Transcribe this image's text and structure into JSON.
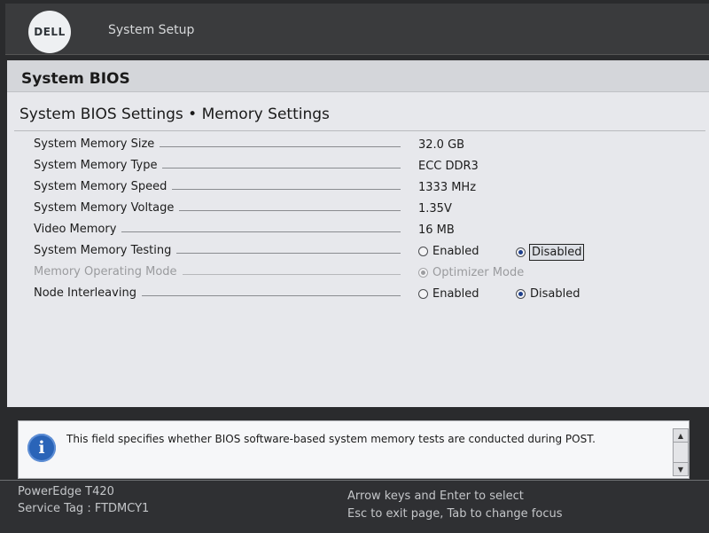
{
  "header": {
    "logo_text": "DELL",
    "title": "System Setup"
  },
  "panel": {
    "header_title": "System BIOS",
    "page_title": "System BIOS Settings • Memory Settings"
  },
  "settings": [
    {
      "label": "System Memory Size",
      "value": "32.0 GB"
    },
    {
      "label": "System Memory Type",
      "value": "ECC DDR3"
    },
    {
      "label": "System Memory Speed",
      "value": "1333 MHz"
    },
    {
      "label": "System Memory Voltage",
      "value": "1.35V"
    },
    {
      "label": "Video Memory",
      "value": "16 MB"
    },
    {
      "label": "System Memory Testing",
      "options": [
        "Enabled",
        "Disabled"
      ],
      "selected": "Disabled"
    },
    {
      "label": "Memory Operating Mode",
      "options": [
        "Optimizer Mode"
      ],
      "selected": "Optimizer Mode",
      "state": "disabled"
    },
    {
      "label": "Node Interleaving",
      "options": [
        "Enabled",
        "Disabled"
      ],
      "selected": "Disabled"
    }
  ],
  "help": {
    "icon": "info-icon",
    "text": "This field specifies whether BIOS software-based system memory tests are conducted during POST."
  },
  "footer": {
    "model": "PowerEdge T420",
    "service_tag": "Service Tag : FTDMCY1",
    "hint_line1": "Arrow keys and Enter to select",
    "hint_line2": "Esc to exit page, Tab to change focus"
  },
  "colors": {
    "accent": "#2a64b8",
    "panel_bg": "#e7e8ec",
    "topbar_bg": "#3a3b3d"
  }
}
